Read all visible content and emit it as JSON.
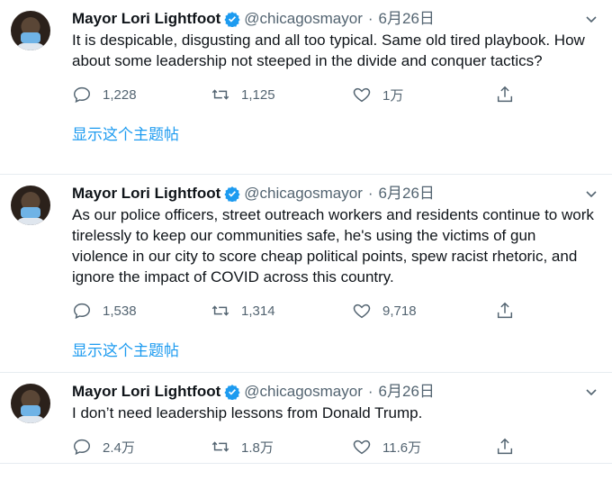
{
  "tweets": [
    {
      "name": "Mayor Lori Lightfoot",
      "handle": "@chicagosmayor",
      "dot": "·",
      "date": "6月26日",
      "text": "It is despicable, disgusting and all too typical. Same old tired playbook. How about some leadership not steeped in the divide and conquer tactics?",
      "replies": "1,228",
      "retweets": "1,125",
      "likes": "1万",
      "show_thread": "显示这个主题帖"
    },
    {
      "name": "Mayor Lori Lightfoot",
      "handle": "@chicagosmayor",
      "dot": "·",
      "date": "6月26日",
      "text": "As our police officers, street outreach workers and residents continue to work tirelessly to keep our communities safe, he's using the victims of gun violence in our city to score cheap political points, spew racist rhetoric, and ignore the impact of COVID across this country.",
      "replies": "1,538",
      "retweets": "1,314",
      "likes": "9,718",
      "show_thread": "显示这个主题帖"
    },
    {
      "name": "Mayor Lori Lightfoot",
      "handle": "@chicagosmayor",
      "dot": "·",
      "date": "6月26日",
      "text": "I don’t need leadership lessons from Donald Trump.",
      "replies": "2.4万",
      "retweets": "1.8万",
      "likes": "11.6万"
    }
  ],
  "colors": {
    "accent": "#1d9bf0",
    "muted": "#536471",
    "text": "#0f1419",
    "divider": "#e6ecf0"
  },
  "icons": [
    "verified-badge-icon",
    "chevron-down-icon",
    "reply-icon",
    "retweet-icon",
    "like-icon",
    "share-icon"
  ]
}
